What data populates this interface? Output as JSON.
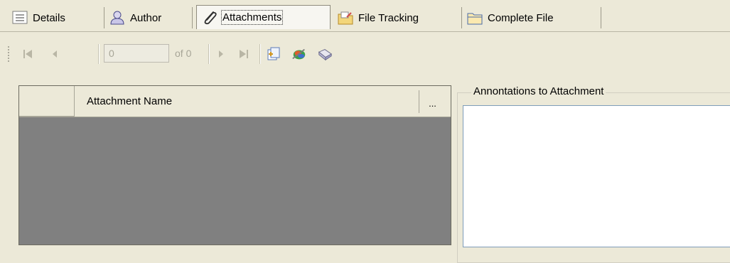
{
  "tabs": [
    {
      "label": "Details",
      "icon": "list-icon"
    },
    {
      "label": "Author",
      "icon": "person-icon"
    },
    {
      "label": "Attachments",
      "icon": "paperclip-icon",
      "active": true
    },
    {
      "label": "File Tracking",
      "icon": "folder-tracking-icon"
    },
    {
      "label": "Complete File",
      "icon": "folder-icon"
    }
  ],
  "navigator": {
    "position_value": "0",
    "of_label": "of 0"
  },
  "grid": {
    "column_header": "Attachment Name",
    "ellipsis": "..."
  },
  "annotations": {
    "title": "Annontations to Attachment",
    "value": ""
  },
  "colors": {
    "background": "#ece9d8",
    "grid_empty": "#808080",
    "disabled_text": "#a7a597",
    "active_tab": "#f7f6f1"
  }
}
